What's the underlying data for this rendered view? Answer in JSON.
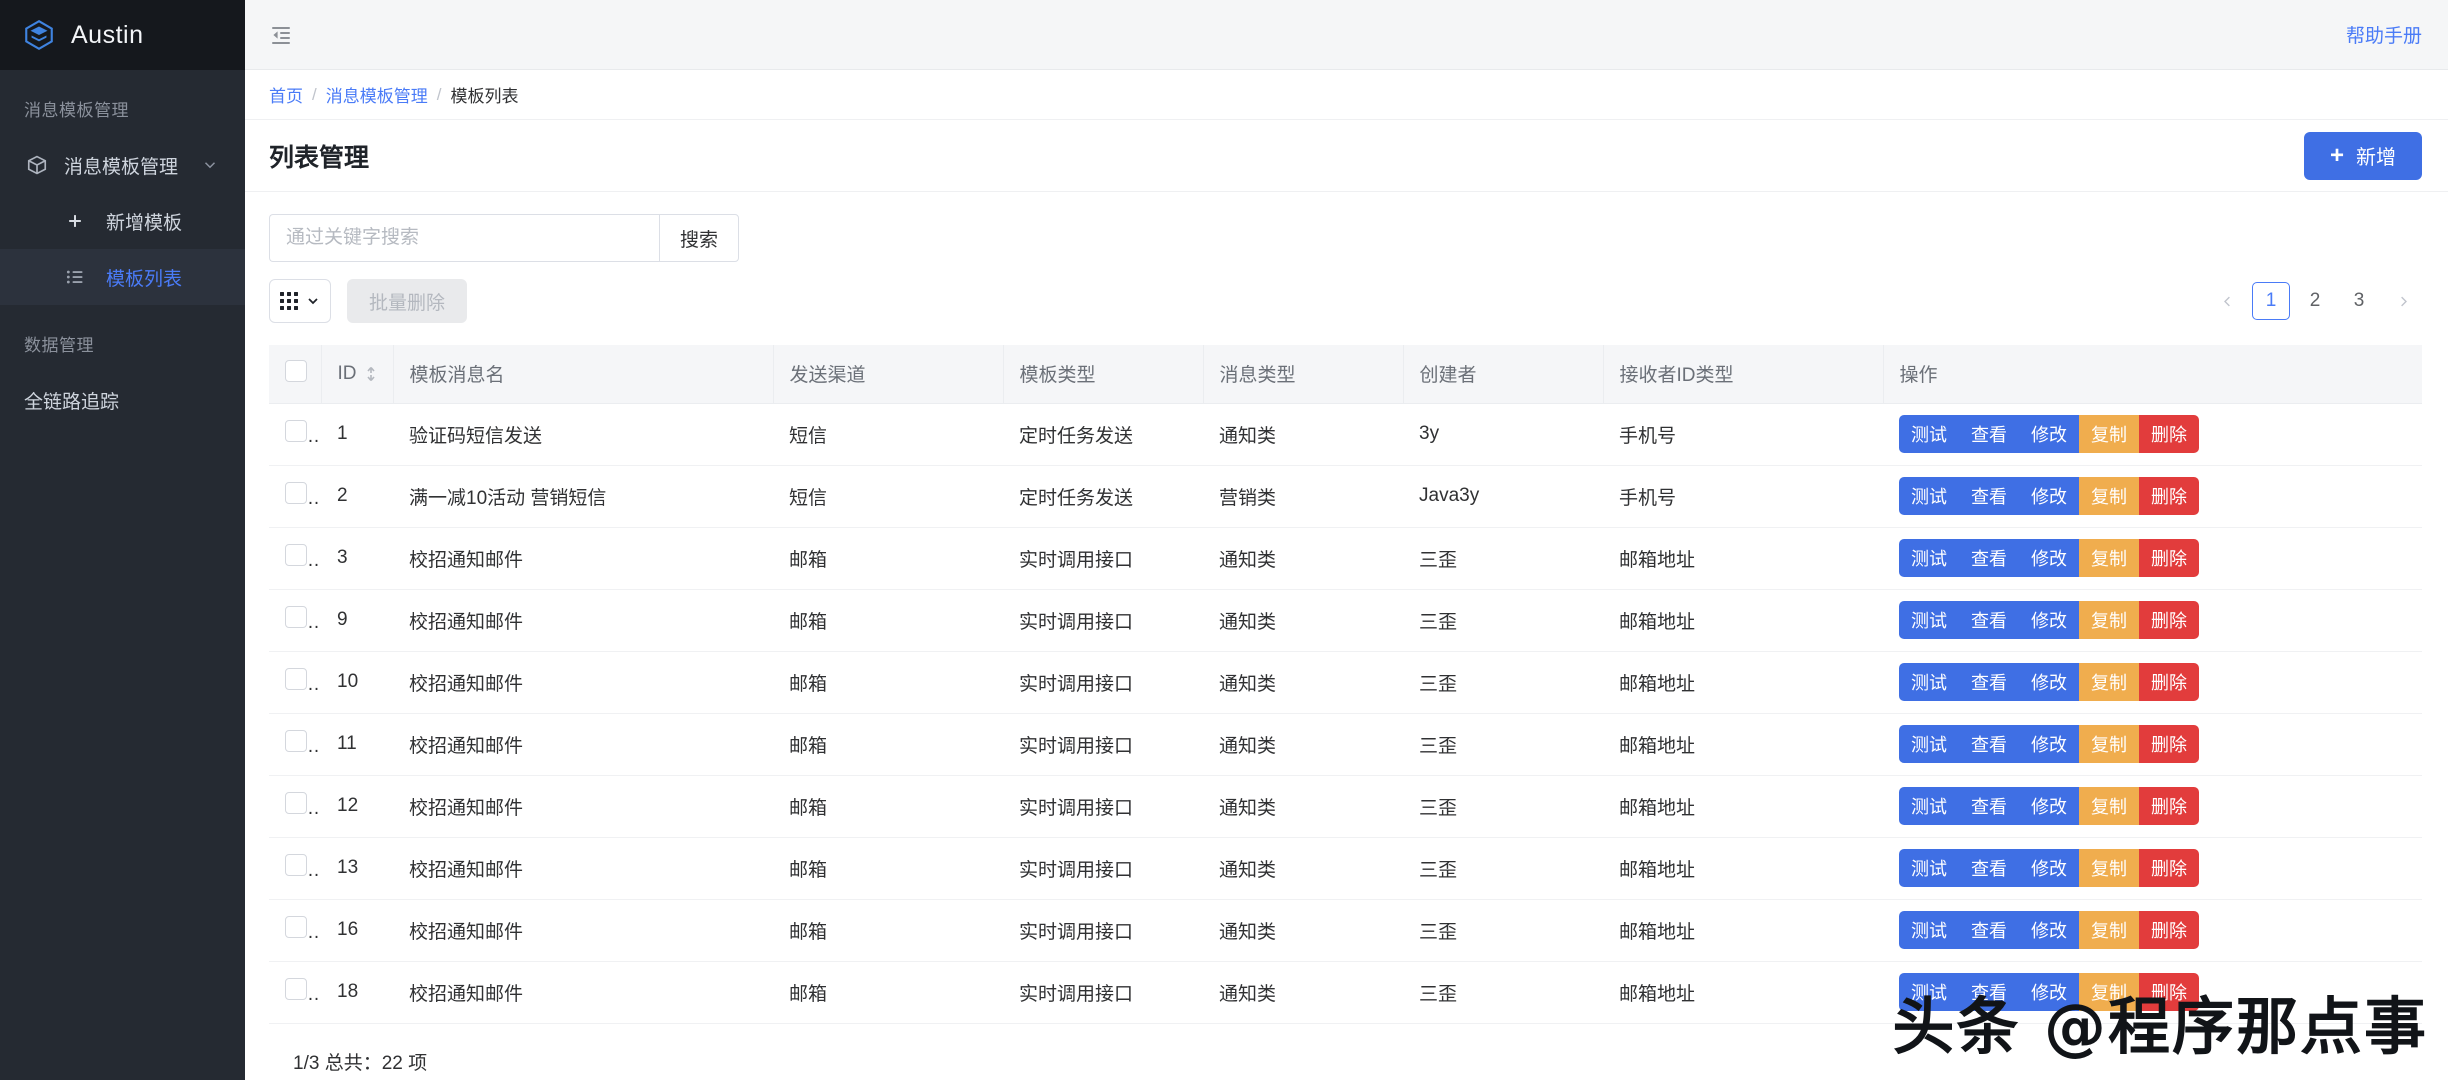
{
  "sidebar": {
    "brand": "Austin",
    "logo_icon": "layers-hexagon-icon",
    "accent": "#4a7bf7",
    "groups": [
      {
        "title": "消息模板管理",
        "items": [
          {
            "label": "消息模板管理",
            "icon": "box-icon",
            "caret": "chevron-down-icon",
            "active": false,
            "sub": false
          },
          {
            "label": "新增模板",
            "icon": "plus-icon",
            "active": false,
            "sub": true
          },
          {
            "label": "模板列表",
            "icon": "list-icon",
            "active": true,
            "sub": true
          }
        ]
      },
      {
        "title": "数据管理",
        "items": [
          {
            "label": "全链路追踪",
            "icon": "none",
            "active": false,
            "sub": false
          }
        ]
      }
    ]
  },
  "topbar": {
    "collapse_icon": "menu-fold-icon",
    "help_label": "帮助手册"
  },
  "breadcrumb": {
    "items": [
      "首页",
      "消息模板管理",
      "模板列表"
    ],
    "separator": "/"
  },
  "page": {
    "title": "列表管理",
    "add_button": {
      "label": "新增",
      "icon": "plus-icon"
    }
  },
  "search": {
    "placeholder": "通过关键字搜索",
    "value": "",
    "button_label": "搜索"
  },
  "ops": {
    "grid_toggle_icon": "grid-3x3-icon",
    "grid_toggle_caret": "chevron-down-icon",
    "batch_delete_label": "批量删除",
    "batch_delete_disabled": true
  },
  "pagination": {
    "prev_icon": "chevron-left-icon",
    "next_icon": "chevron-right-icon",
    "pages": [
      "1",
      "2",
      "3"
    ],
    "current": "1"
  },
  "table": {
    "columns": [
      {
        "key": "check",
        "label": ""
      },
      {
        "key": "id",
        "label": "ID",
        "sortable": true
      },
      {
        "key": "name",
        "label": "模板消息名"
      },
      {
        "key": "channel",
        "label": "发送渠道"
      },
      {
        "key": "tmpl_type",
        "label": "模板类型"
      },
      {
        "key": "msg_type",
        "label": "消息类型"
      },
      {
        "key": "creator",
        "label": "创建者"
      },
      {
        "key": "receiver_type",
        "label": "接收者ID类型"
      },
      {
        "key": "ops",
        "label": "操作"
      }
    ],
    "row_actions": [
      {
        "label": "测试",
        "style": "blue"
      },
      {
        "label": "查看",
        "style": "blue"
      },
      {
        "label": "修改",
        "style": "blue"
      },
      {
        "label": "复制",
        "style": "orange"
      },
      {
        "label": "删除",
        "style": "red"
      }
    ],
    "rows": [
      {
        "id": "1",
        "name": "验证码短信发送",
        "channel": "短信",
        "tmpl_type": "定时任务发送",
        "msg_type": "通知类",
        "creator": "3y",
        "receiver_type": "手机号",
        "checked": false
      },
      {
        "id": "2",
        "name": "满一减10活动 营销短信",
        "channel": "短信",
        "tmpl_type": "定时任务发送",
        "msg_type": "营销类",
        "creator": "Java3y",
        "receiver_type": "手机号",
        "checked": false
      },
      {
        "id": "3",
        "name": "校招通知邮件",
        "channel": "邮箱",
        "tmpl_type": "实时调用接口",
        "msg_type": "通知类",
        "creator": "三歪",
        "receiver_type": "邮箱地址",
        "checked": false
      },
      {
        "id": "9",
        "name": "校招通知邮件",
        "channel": "邮箱",
        "tmpl_type": "实时调用接口",
        "msg_type": "通知类",
        "creator": "三歪",
        "receiver_type": "邮箱地址",
        "checked": false
      },
      {
        "id": "10",
        "name": "校招通知邮件",
        "channel": "邮箱",
        "tmpl_type": "实时调用接口",
        "msg_type": "通知类",
        "creator": "三歪",
        "receiver_type": "邮箱地址",
        "checked": false
      },
      {
        "id": "11",
        "name": "校招通知邮件",
        "channel": "邮箱",
        "tmpl_type": "实时调用接口",
        "msg_type": "通知类",
        "creator": "三歪",
        "receiver_type": "邮箱地址",
        "checked": false
      },
      {
        "id": "12",
        "name": "校招通知邮件",
        "channel": "邮箱",
        "tmpl_type": "实时调用接口",
        "msg_type": "通知类",
        "creator": "三歪",
        "receiver_type": "邮箱地址",
        "checked": false
      },
      {
        "id": "13",
        "name": "校招通知邮件",
        "channel": "邮箱",
        "tmpl_type": "实时调用接口",
        "msg_type": "通知类",
        "creator": "三歪",
        "receiver_type": "邮箱地址",
        "checked": false
      },
      {
        "id": "16",
        "name": "校招通知邮件",
        "channel": "邮箱",
        "tmpl_type": "实时调用接口",
        "msg_type": "通知类",
        "creator": "三歪",
        "receiver_type": "邮箱地址",
        "checked": false
      },
      {
        "id": "18",
        "name": "校招通知邮件",
        "channel": "邮箱",
        "tmpl_type": "实时调用接口",
        "msg_type": "通知类",
        "creator": "三歪",
        "receiver_type": "邮箱地址",
        "checked": false
      }
    ],
    "footer_text": "1/3 总共：22 项"
  },
  "watermark": {
    "text": "头条 @程序那点事"
  },
  "colors": {
    "primary": "#3f6fe4",
    "link": "#4a7bf7",
    "warning": "#f0ad4e",
    "danger": "#e23c3c",
    "sidebar_bg": "#252a32",
    "sidebar_logo_bg": "#15181d"
  }
}
